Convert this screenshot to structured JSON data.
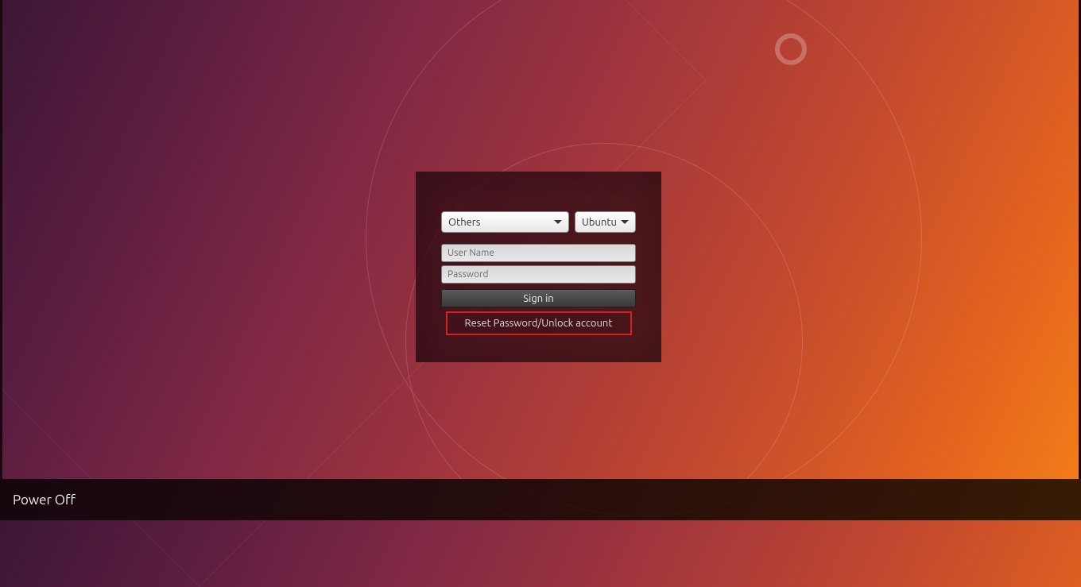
{
  "login": {
    "user_dropdown_label": "Others",
    "session_dropdown_label": "Ubuntu",
    "username_placeholder": "User Name",
    "username_value": "",
    "password_placeholder": "Password",
    "password_value": "",
    "signin_label": "Sign in",
    "reset_label": "Reset Password/Unlock account"
  },
  "bottombar": {
    "power_label": "Power Off"
  }
}
